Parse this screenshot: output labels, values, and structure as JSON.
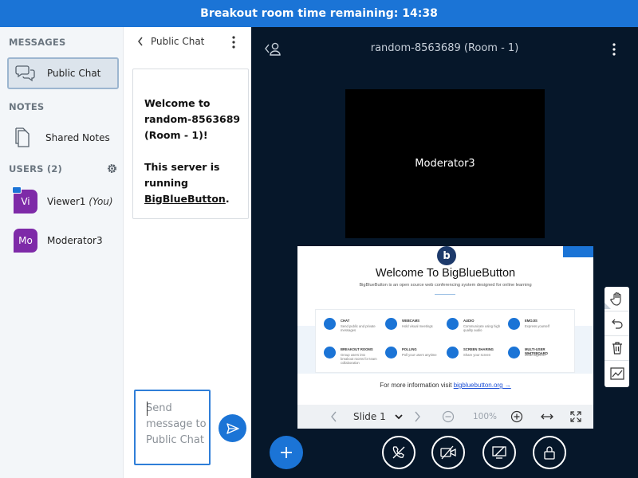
{
  "topbar": {
    "text": "Breakout room time remaining: 14:38"
  },
  "sidebar": {
    "messages_title": "MESSAGES",
    "public_chat_label": "Public Chat",
    "notes_title": "NOTES",
    "shared_notes_label": "Shared Notes",
    "users_title": "USERS (2)",
    "users": [
      {
        "initials": "Vi",
        "name": "Viewer1",
        "suffix": "(You)"
      },
      {
        "initials": "Mo",
        "name": "Moderator3",
        "suffix": ""
      }
    ]
  },
  "chat": {
    "title": "Public Chat",
    "welcome_line1": "Welcome to",
    "welcome_line2": "random-8563689",
    "welcome_line3": "(Room - 1)!",
    "welcome_line4": "This server is",
    "welcome_line5": "running",
    "welcome_link": "BigBlueButton",
    "welcome_end": ".",
    "input_placeholder": "Send message to Public Chat"
  },
  "main": {
    "room_title": "random-8563689 (Room - 1)",
    "video_name": "Moderator3"
  },
  "slide": {
    "heading": "Welcome To BigBlueButton",
    "subheading": "BigBlueButton is an open source web conferencing system designed for online learning",
    "logo": "b",
    "features": [
      {
        "title": "CHAT",
        "desc": "Send public and private messages"
      },
      {
        "title": "WEBCAMS",
        "desc": "Hold visual meetings"
      },
      {
        "title": "AUDIO",
        "desc": "Communicate using high quality audio"
      },
      {
        "title": "EMOJIS",
        "desc": "Express yourself"
      },
      {
        "title": "BREAKOUT ROOMS",
        "desc": "Group users into breakout rooms for team collaboration"
      },
      {
        "title": "POLLING",
        "desc": "Poll your users anytime"
      },
      {
        "title": "SCREEN SHARING",
        "desc": "Share your screen"
      },
      {
        "title": "MULTI-USER WHITEBOARD",
        "desc": "Draw together"
      }
    ],
    "more_prefix": "For more information visit",
    "more_link": "bigbluebutton.org →"
  },
  "slide_controls": {
    "slide_label": "Slide 1",
    "zoom": "100%"
  },
  "colors": {
    "accent": "#1b74d6",
    "main_bg": "#06172a",
    "avatar": "#7e2aa8"
  }
}
